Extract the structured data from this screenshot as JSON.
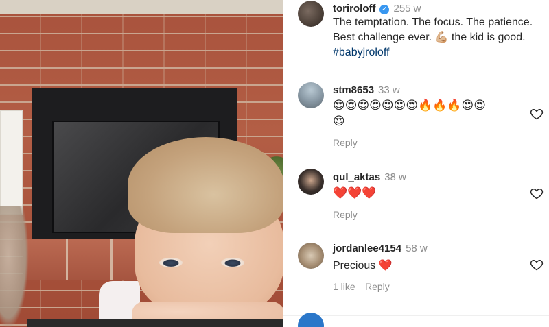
{
  "post": {
    "author": "toriroloff",
    "age": "255 w",
    "caption_text": "The temptation. The focus. The patience. Best challenge ever. 💪🏼 the kid is good. ",
    "hashtag": "#babyjroloff"
  },
  "comments": [
    {
      "username": "stm8653",
      "age": "33 w",
      "text_line1": "😍😍😍😍😍😍😍🔥🔥🔥😍😍",
      "text_line2": "😍",
      "reply_label": "Reply"
    },
    {
      "username": "qul_aktas",
      "age": "38 w",
      "text_line1": "❤️❤️❤️",
      "reply_label": "Reply"
    },
    {
      "username": "jordanlee4154",
      "age": "58 w",
      "text": "Precious ❤️",
      "likes_label": "1 like",
      "reply_label": "Reply"
    }
  ],
  "icons": {
    "verified": "verified-badge-icon",
    "like": "heart-outline-icon"
  },
  "colors": {
    "verified_blue": "#3897f0",
    "hashtag": "#00376b",
    "muted": "#8e8e8e"
  }
}
